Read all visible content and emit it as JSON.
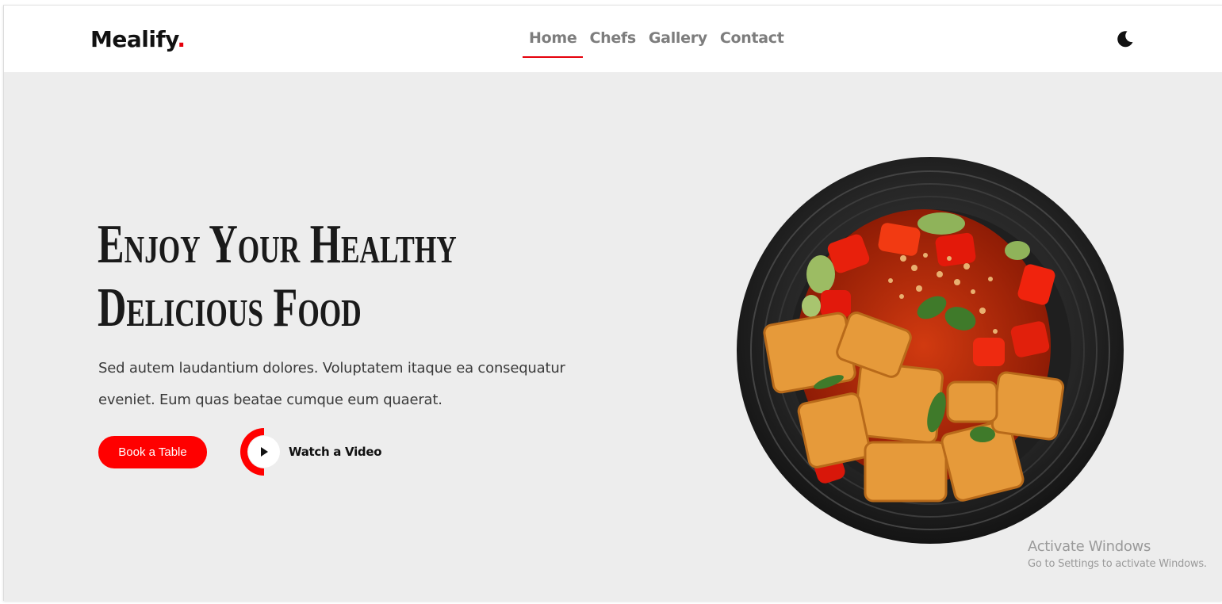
{
  "brand": {
    "name": "Mealify",
    "dot": ".",
    "accent": "#e5000b"
  },
  "nav": {
    "items": [
      {
        "label": "Home",
        "active": true
      },
      {
        "label": "Chefs",
        "active": false
      },
      {
        "label": "Gallery",
        "active": false
      },
      {
        "label": "Contact",
        "active": false
      }
    ],
    "theme_icon": "moon-icon"
  },
  "hero": {
    "title_line1": "Enjoy Your Healthy",
    "title_line2": "Delicious Food",
    "description": "Sed autem laudantium dolores. Voluptatem itaque ea consequatur eveniet. Eum quas beatae cumque eum quaerat.",
    "book_label": "Book a Table",
    "watch_label": "Watch a Video",
    "play_icon": "play-icon",
    "image": "food-plate-image"
  },
  "watermark": {
    "title": "Activate Windows",
    "subtitle": "Go to Settings to activate Windows."
  },
  "colors": {
    "background": "#ededed",
    "header": "#ffffff",
    "primary": "#ff0000",
    "text": "#1a1a1a"
  }
}
